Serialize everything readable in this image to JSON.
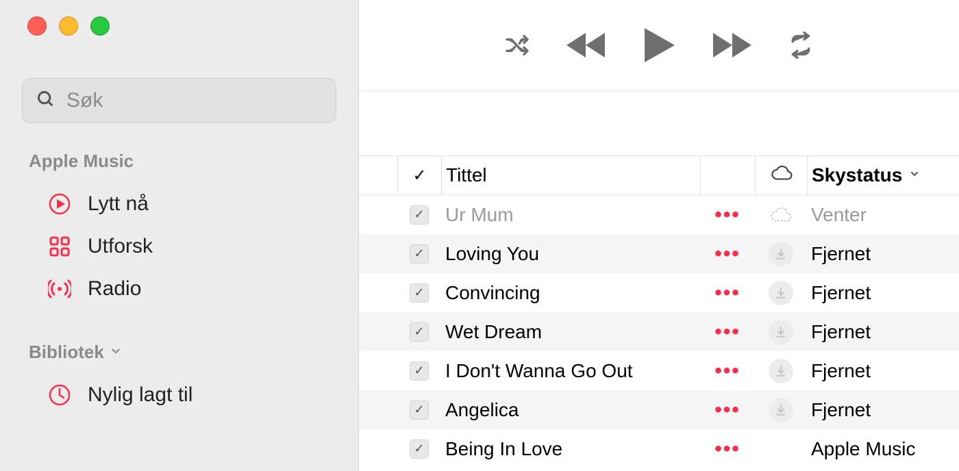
{
  "search": {
    "placeholder": "Søk"
  },
  "sidebar": {
    "section_music_label": "Apple Music",
    "section_library_label": "Bibliotek",
    "items": {
      "listen_now": "Lytt nå",
      "explore": "Utforsk",
      "radio": "Radio",
      "recently_added": "Nylig lagt til"
    }
  },
  "table": {
    "header": {
      "check": "✓",
      "title": "Tittel",
      "skystatus": "Skystatus"
    },
    "rows": [
      {
        "title": "Ur Mum",
        "status": "Venter",
        "cloud": "dashed",
        "pending": true
      },
      {
        "title": "Loving You",
        "status": "Fjernet",
        "cloud": "removed",
        "pending": false
      },
      {
        "title": "Convincing",
        "status": "Fjernet",
        "cloud": "removed",
        "pending": false
      },
      {
        "title": "Wet Dream",
        "status": "Fjernet",
        "cloud": "removed",
        "pending": false
      },
      {
        "title": "I Don't Wanna Go Out",
        "status": "Fjernet",
        "cloud": "removed",
        "pending": false
      },
      {
        "title": "Angelica",
        "status": "Fjernet",
        "cloud": "removed",
        "pending": false
      },
      {
        "title": "Being In Love",
        "status": "Apple Music",
        "cloud": "none",
        "pending": false
      }
    ]
  },
  "colors": {
    "accent": "#fa2e48"
  }
}
